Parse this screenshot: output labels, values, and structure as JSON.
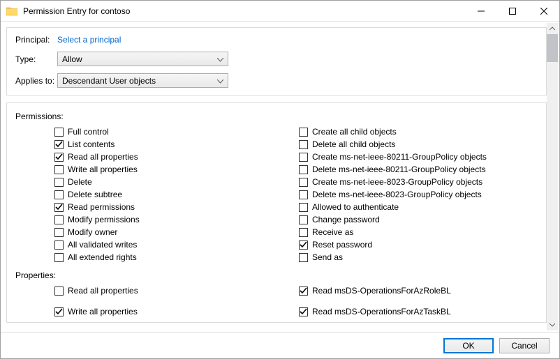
{
  "window": {
    "title": "Permission Entry for contoso"
  },
  "header": {
    "principal_label": "Principal:",
    "principal_link": "Select a principal",
    "type_label": "Type:",
    "type_value": "Allow",
    "applies_label": "Applies to:",
    "applies_value": "Descendant User objects"
  },
  "sections": {
    "permissions_label": "Permissions:",
    "properties_label": "Properties:"
  },
  "permissions_left": [
    {
      "label": "Full control",
      "checked": false
    },
    {
      "label": "List contents",
      "checked": true
    },
    {
      "label": "Read all properties",
      "checked": true
    },
    {
      "label": "Write all properties",
      "checked": false
    },
    {
      "label": "Delete",
      "checked": false
    },
    {
      "label": "Delete subtree",
      "checked": false
    },
    {
      "label": "Read permissions",
      "checked": true
    },
    {
      "label": "Modify permissions",
      "checked": false
    },
    {
      "label": "Modify owner",
      "checked": false
    },
    {
      "label": "All validated writes",
      "checked": false
    },
    {
      "label": "All extended rights",
      "checked": false
    }
  ],
  "permissions_right": [
    {
      "label": "Create all child objects",
      "checked": false
    },
    {
      "label": "Delete all child objects",
      "checked": false
    },
    {
      "label": "Create ms-net-ieee-80211-GroupPolicy objects",
      "checked": false
    },
    {
      "label": "Delete ms-net-ieee-80211-GroupPolicy objects",
      "checked": false
    },
    {
      "label": "Create ms-net-ieee-8023-GroupPolicy objects",
      "checked": false
    },
    {
      "label": "Delete ms-net-ieee-8023-GroupPolicy objects",
      "checked": false
    },
    {
      "label": "Allowed to authenticate",
      "checked": false
    },
    {
      "label": "Change password",
      "checked": false
    },
    {
      "label": "Receive as",
      "checked": false
    },
    {
      "label": "Reset password",
      "checked": true
    },
    {
      "label": "Send as",
      "checked": false
    }
  ],
  "properties_left": [
    {
      "label": "Read all properties",
      "checked": false
    },
    {
      "label": "Write all properties",
      "checked": true
    }
  ],
  "properties_right": [
    {
      "label": "Read msDS-OperationsForAzRoleBL",
      "checked": true
    },
    {
      "label": "Read msDS-OperationsForAzTaskBL",
      "checked": true
    }
  ],
  "footer": {
    "ok": "OK",
    "cancel": "Cancel"
  }
}
